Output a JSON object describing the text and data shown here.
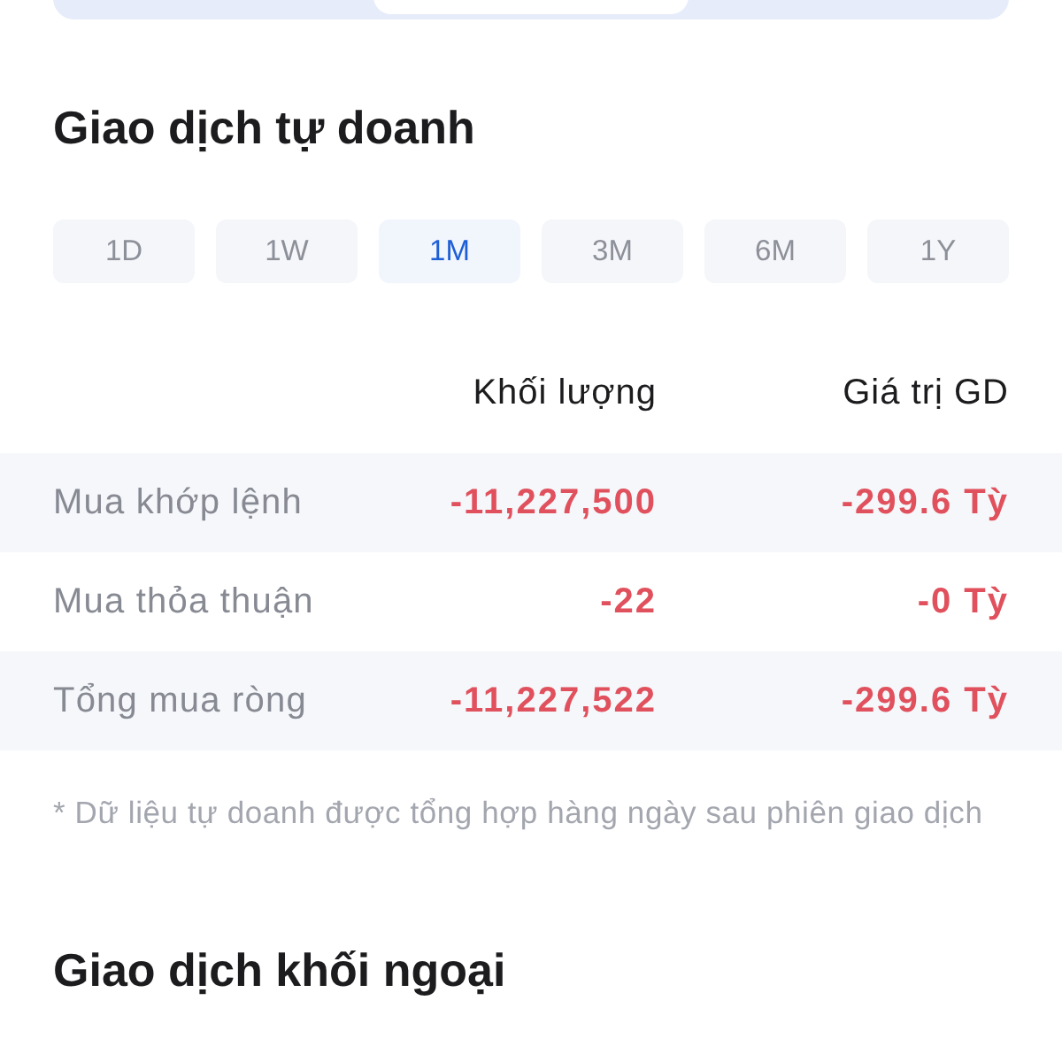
{
  "segmented_control": {
    "segments": [
      {
        "selected": false
      },
      {
        "selected": true
      },
      {
        "selected": false
      }
    ]
  },
  "section": {
    "title": "Giao dịch tự doanh",
    "periods": [
      {
        "label": "1D",
        "selected": false
      },
      {
        "label": "1W",
        "selected": false
      },
      {
        "label": "1M",
        "selected": true
      },
      {
        "label": "3M",
        "selected": false
      },
      {
        "label": "6M",
        "selected": false
      },
      {
        "label": "1Y",
        "selected": false
      }
    ],
    "table": {
      "columns": [
        "Khối lượng",
        "Giá trị GD"
      ],
      "rows": [
        {
          "label": "Mua khớp lệnh",
          "volume": "-11,227,500",
          "value": "-299.6 Tỳ"
        },
        {
          "label": "Mua thỏa thuận",
          "volume": "-22",
          "value": "-0 Tỳ"
        },
        {
          "label": "Tổng mua ròng",
          "volume": "-11,227,522",
          "value": "-299.6 Tỳ"
        }
      ]
    },
    "footnote": "* Dữ liệu tự doanh được tổng hợp hàng ngày sau phiên giao dịch"
  },
  "next_section": {
    "title": "Giao dịch khối ngoại"
  }
}
